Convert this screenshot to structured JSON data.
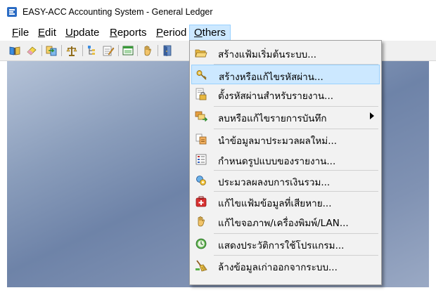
{
  "window": {
    "title": "EASY-ACC Accounting System - General Ledger",
    "icon": "app-logo-icon"
  },
  "menubar": {
    "items": [
      {
        "label": "File",
        "underline": "F"
      },
      {
        "label": "Edit",
        "underline": "E"
      },
      {
        "label": "Update",
        "underline": "U"
      },
      {
        "label": "Reports",
        "underline": "R"
      },
      {
        "label": "Period",
        "underline": "P"
      },
      {
        "label": "Others",
        "underline": "O",
        "active": true
      }
    ]
  },
  "toolbar": {
    "icons": [
      "open-book-icon",
      "eraser-icon",
      "transfer-icon",
      "scale-icon",
      "tree-icon",
      "edit-form-icon",
      "window-icon",
      "hand-icon",
      "exit-door-icon"
    ]
  },
  "others_menu": {
    "items": [
      {
        "label": "สร้างแฟ้มเริ่มต้นระบบ...",
        "icon": "folder-open-icon"
      },
      {
        "label": "สร้างหรือแก้ไขรหัสผ่าน...",
        "icon": "key-icon",
        "highlighted": true
      },
      {
        "label": "ตั้งรหัสผ่านสำหรับรายงาน...",
        "icon": "lock-report-icon"
      },
      {
        "label": "ลบหรือแก้ไขรายการบันทึก",
        "icon": "edit-records-icon",
        "submenu": true
      },
      {
        "label": "นำข้อมูลมาประมวลผลใหม่...",
        "icon": "reprocess-icon"
      },
      {
        "label": "กำหนดรูปแบบของรายงาน...",
        "icon": "report-format-icon"
      },
      {
        "label": "ประมวลผลงบการเงินรวม...",
        "icon": "consolidate-icon"
      },
      {
        "label": "แก้ไขแฟ้มข้อมูลที่เสียหาย...",
        "icon": "first-aid-icon"
      },
      {
        "label": "แก้ไขจอภาพ/เครื่องพิมพ์/LAN...",
        "icon": "hand-config-icon"
      },
      {
        "label": "แสดงประวัติการใช้โปรแกรม...",
        "icon": "history-icon"
      },
      {
        "label": "ล้างข้อมูลเก่าออกจากระบบ...",
        "icon": "broom-icon"
      }
    ]
  },
  "colors": {
    "highlight": "#cce8ff",
    "highlight_border": "#99d1ff",
    "menu_bg": "#f2f2f2"
  }
}
